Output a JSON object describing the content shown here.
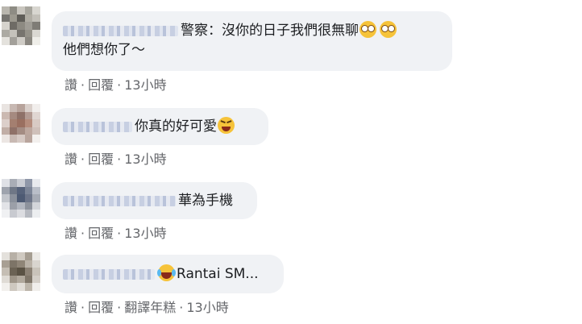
{
  "comments": [
    {
      "text_line1": "警察：沒你的日子我們很無聊",
      "text_line2": "他們想你了～",
      "actions": {
        "like": "讚",
        "reply": "回覆",
        "time": "13小時"
      }
    },
    {
      "text": "你真的好可愛",
      "actions": {
        "like": "讚",
        "reply": "回覆",
        "time": "13小時"
      }
    },
    {
      "text": "華為手機",
      "actions": {
        "like": "讚",
        "reply": "回覆",
        "time": "13小時"
      }
    },
    {
      "text": "Rantai SM...",
      "actions": {
        "like": "讚",
        "reply": "回覆",
        "translate": "翻譯年糕",
        "time": "13小時"
      }
    }
  ],
  "separator": "·",
  "icons": {
    "c0": [
      "flushed-face-icon",
      "flushed-face-icon"
    ],
    "c1": "squinting-tongue-face-icon",
    "c3": "tears-of-joy-face-icon"
  },
  "colors": {
    "bubble": "#f0f2f5",
    "action_text": "#65676b",
    "text": "#1c1e21"
  }
}
